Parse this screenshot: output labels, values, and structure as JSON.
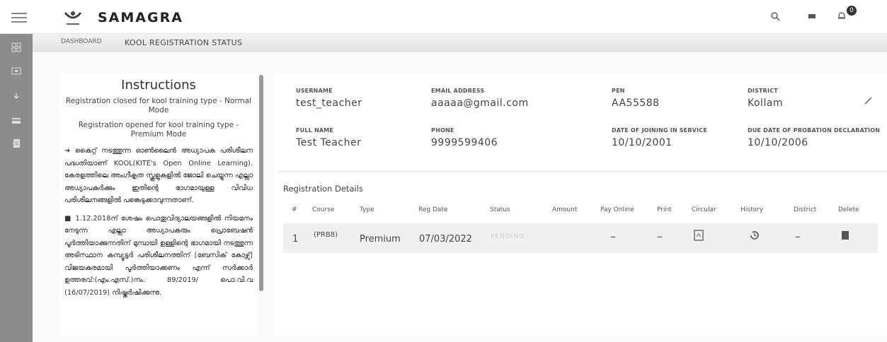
{
  "header": {
    "app_name": "SAMAGRA",
    "menu_icon": "hamburger-icon",
    "search_icon": "search-icon",
    "message_icon": "message-icon",
    "notification_icon": "bell-icon",
    "notification_count": "0"
  },
  "sidebar": {
    "items": [
      {
        "icon": "grid-icon"
      },
      {
        "icon": "monitor-icon"
      },
      {
        "icon": "download-icon"
      },
      {
        "icon": "card-icon"
      },
      {
        "icon": "document-icon"
      }
    ]
  },
  "breadcrumb": {
    "home": "DASHBOARD",
    "current": "KOOL REGISTRATION STATUS"
  },
  "instructions": {
    "title": "Instructions",
    "line1": "Registration closed for kool training type - Normal Mode",
    "line2": "Registration opened for kool training type - Premium Mode",
    "para1": "➜ കൈറ്റ് നടത്തുന്ന ഓൺലൈൻ അധ്യാപക പരിശീലന പദ്ധതിയാണ് KOOL(KITE's Open Online Learning). കേരളത്തിലെ അംഗീകൃത സ്കൂളുകളിൽ ജോലി ചെയ്യുന്ന എല്ലാ അധ്യാപകർക്കും ഇതിന്റെ ഭാഗമായുള്ള വിവിധ പരിശീലനങ്ങളിൽ പങ്കെടുക്കാവുന്നതാണ്.",
    "para2": "■ 1.12.2018ന് ശേഷം പൊതുവിദ്യാലയങ്ങളിൽ നിയമനം നേടുന്ന എല്ലാ അധ്യാപകരും പ്രൊബേഷൻ പൂർത്തിയാക്കുന്നതിന് മുമ്പായി ഉള്ളിന്റെ ഭാഗമായി നടത്തുന്ന അടിസ്ഥാന കമ്പ്യൂട്ടർ പരിശീലനത്തിന് [ബേസിക് കോഴ്സ്] വിജയകരമായി പൂർത്തിയാക്കണം എന്ന് സർക്കാർ ഉത്തരവ്:(എം.എസ്.)നം. 89/2019/ പൊ.വി.വ (16/07/2019) നിഷ്കർഷിക്കുന്നു."
  },
  "profile": {
    "username_label": "USERNAME",
    "username": "test_teacher",
    "email_label": "EMAIL ADDRESS",
    "email": "aaaaa@gmail.com",
    "pen_label": "PEN",
    "pen": "AA55588",
    "district_label": "DISTRICT",
    "district": "Kollam",
    "fullname_label": "FULL NAME",
    "fullname": "Test Teacher",
    "phone_label": "PHONE",
    "phone": "9999599406",
    "doj_label": "DATE OF JOINING IN SERVICE",
    "doj": "10/10/2001",
    "probation_label": "DUE DATE OF PROBATION DECLARATION",
    "probation": "10/10/2006"
  },
  "registration": {
    "title": "Registration Details",
    "columns": [
      "#",
      "Course",
      "Type",
      "Reg Date",
      "Status",
      "Amount",
      "Pay Online",
      "Print",
      "Circular",
      "History",
      "District",
      "Delete"
    ],
    "row": {
      "num": "1",
      "course": "(PRB8)",
      "type": "Premium",
      "reg_date": "07/03/2022",
      "status": "PENDING",
      "amount": "",
      "pay_online": "–",
      "print": "–",
      "circular_icon": "pdf-icon",
      "history_icon": "history-icon",
      "district": "–",
      "delete_icon": "trash-icon"
    }
  }
}
